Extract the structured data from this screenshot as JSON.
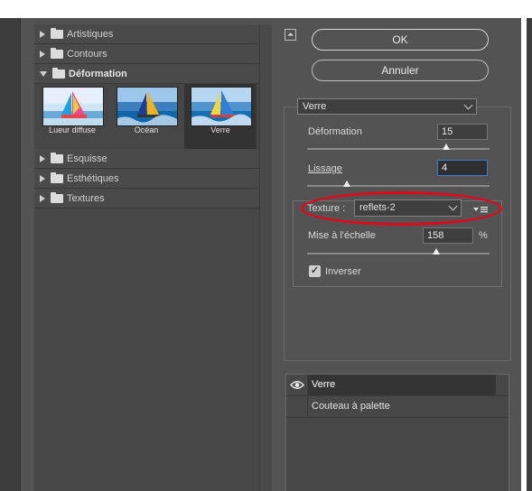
{
  "gallery": {
    "categories": [
      {
        "label": "Artistiques",
        "expanded": false
      },
      {
        "label": "Contours",
        "expanded": false
      },
      {
        "label": "Déformation",
        "expanded": true
      },
      {
        "label": "Esquisse",
        "expanded": false
      },
      {
        "label": "Esthétiques",
        "expanded": false
      },
      {
        "label": "Textures",
        "expanded": false
      }
    ],
    "thumbnails": [
      {
        "caption": "Lueur diffuse",
        "selected": false
      },
      {
        "caption": "Océan",
        "selected": false
      },
      {
        "caption": "Verre",
        "selected": true
      }
    ]
  },
  "buttons": {
    "collapse_glyph": "⏶",
    "ok": "OK",
    "cancel": "Annuler"
  },
  "filter": {
    "selected": "Verre",
    "deformation": {
      "label": "Déformation",
      "value": "15",
      "slider": 0.76
    },
    "lissage": {
      "label": "Lissage",
      "value": "4",
      "slider": 0.22
    },
    "texture": {
      "label": "Texture :",
      "value": "reflets-2"
    },
    "echelle": {
      "label": "Mise à l'échelle",
      "value": "158",
      "unit": "%",
      "slider": 0.71
    },
    "inverser": {
      "label": "Inverser",
      "checked": true
    }
  },
  "layers": [
    {
      "name": "Verre",
      "visible": true,
      "active": true
    },
    {
      "name": "Couteau à palette",
      "visible": false,
      "active": false
    }
  ],
  "colors": {
    "accent_ring": "#e0091b",
    "focus": "#3b7cd0"
  }
}
